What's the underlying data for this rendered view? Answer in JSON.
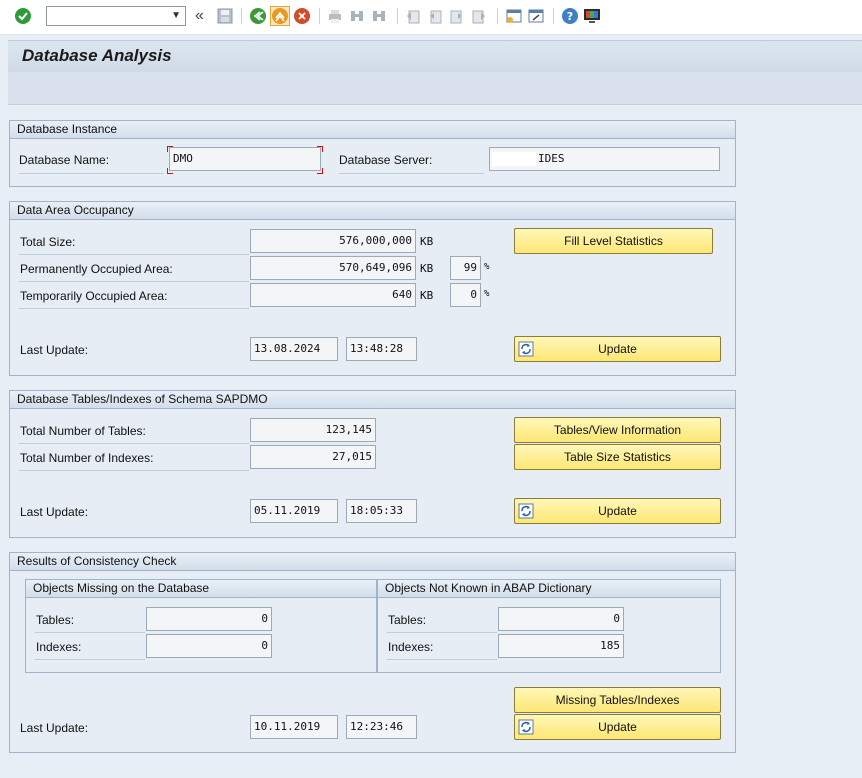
{
  "toolbar": {
    "command_field_value": "",
    "icons": [
      "enter-icon",
      "back-icon",
      "save-icon",
      "back-green-icon",
      "exit-icon",
      "cancel-icon",
      "print-icon",
      "find-icon",
      "find-next-icon",
      "first-page-icon",
      "previous-page-icon",
      "next-page-icon",
      "last-page-icon",
      "create-session-icon",
      "shortcut-icon",
      "help-icon",
      "customize-layout-icon"
    ]
  },
  "title": "Database Analysis",
  "instance": {
    "header": "Database Instance",
    "db_name_label": "Database Name:",
    "db_name_value": "DMO",
    "db_server_label": "Database Server:",
    "db_server_value": "IDES"
  },
  "occupancy": {
    "header": "Data Area Occupancy",
    "total_size_label": "Total Size:",
    "total_size_value": "576,000,000",
    "perm_label": "Permanently Occupied Area:",
    "perm_value": "570,649,096",
    "perm_pct": "99",
    "temp_label": "Temporarily Occupied Area:",
    "temp_value": "640",
    "temp_pct": "0",
    "unit_kb": "KB",
    "unit_pct": "%",
    "last_update_label": "Last Update:",
    "last_update_date": "13.08.2024",
    "last_update_time": "13:48:28",
    "fill_level_button": "Fill Level Statistics",
    "update_button": "Update"
  },
  "tables": {
    "header": "Database Tables/Indexes of Schema SAPDMO",
    "num_tables_label": "Total Number of Tables:",
    "num_tables_value": "123,145",
    "num_indexes_label": "Total Number of Indexes:",
    "num_indexes_value": "27,015",
    "last_update_label": "Last Update:",
    "last_update_date": "05.11.2019",
    "last_update_time": "18:05:33",
    "tables_view_button": "Tables/View Information",
    "table_size_button": "Table Size Statistics",
    "update_button": "Update"
  },
  "consistency": {
    "header": "Results of Consistency Check",
    "missing": {
      "header": "Objects Missing on the Database",
      "tables_label": "Tables:",
      "tables_value": "0",
      "indexes_label": "Indexes:",
      "indexes_value": "0"
    },
    "unknown": {
      "header": "Objects Not Known in ABAP Dictionary",
      "tables_label": "Tables:",
      "tables_value": "0",
      "indexes_label": "Indexes:",
      "indexes_value": "185"
    },
    "last_update_label": "Last Update:",
    "last_update_date": "10.11.2019",
    "last_update_time": "12:23:46",
    "missing_button": "Missing Tables/Indexes",
    "update_button": "Update"
  },
  "colors": {
    "button_yellow": "#fde774",
    "group_bg": "#e6edf4",
    "group_border": "#9fb4c9"
  }
}
